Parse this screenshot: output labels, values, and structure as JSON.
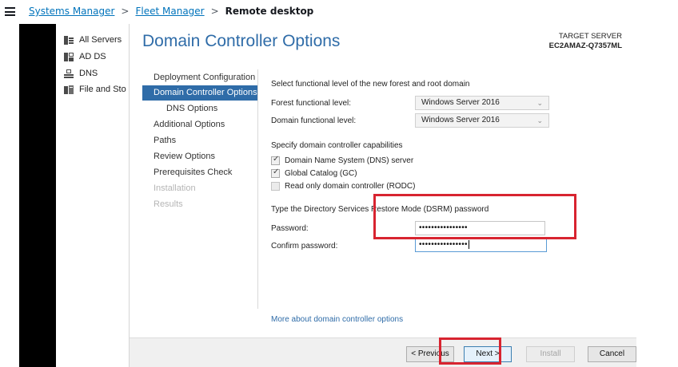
{
  "topbar": {
    "breadcrumbs": [
      "Systems Manager",
      "Fleet Manager"
    ],
    "current": "Remote desktop",
    "separator": ">"
  },
  "server_manager": {
    "items": [
      {
        "label": "All Servers",
        "icon": "all-servers-icon"
      },
      {
        "label": "AD DS",
        "icon": "ad-ds-icon"
      },
      {
        "label": "DNS",
        "icon": "dns-icon"
      },
      {
        "label": "File and Sto",
        "icon": "file-storage-icon"
      }
    ]
  },
  "wizard": {
    "title": "Domain Controller Options",
    "target_label": "TARGET SERVER",
    "target_name": "EC2AMAZ-Q7357ML",
    "nav": [
      {
        "label": "Deployment Configuration"
      },
      {
        "label": "Domain Controller Options"
      },
      {
        "label": "DNS Options"
      },
      {
        "label": "Additional Options"
      },
      {
        "label": "Paths"
      },
      {
        "label": "Review Options"
      },
      {
        "label": "Prerequisites Check"
      },
      {
        "label": "Installation"
      },
      {
        "label": "Results"
      }
    ],
    "functional_heading": "Select functional level of the new forest and root domain",
    "forest_label": "Forest functional level:",
    "forest_value": "Windows Server 2016",
    "domain_label": "Domain functional level:",
    "domain_value": "Windows Server 2016",
    "capabilities_heading": "Specify domain controller capabilities",
    "capabilities": [
      {
        "label": "Domain Name System (DNS) server",
        "checked": true
      },
      {
        "label": "Global Catalog (GC)",
        "checked": true
      },
      {
        "label": "Read only domain controller (RODC)",
        "checked": false
      }
    ],
    "dsrm_heading": "Type the Directory Services Restore Mode (DSRM) password",
    "password_label": "Password:",
    "password_value": "••••••••••••••••",
    "confirm_label": "Confirm password:",
    "confirm_value": "••••••••••••••••",
    "more_link": "More about domain controller options",
    "buttons": {
      "previous": "< Previous",
      "next": "Next >",
      "install": "Install",
      "cancel": "Cancel"
    }
  },
  "colors": {
    "accent": "#2f6ca8",
    "highlight": "#d82430",
    "link": "#0073bb"
  }
}
